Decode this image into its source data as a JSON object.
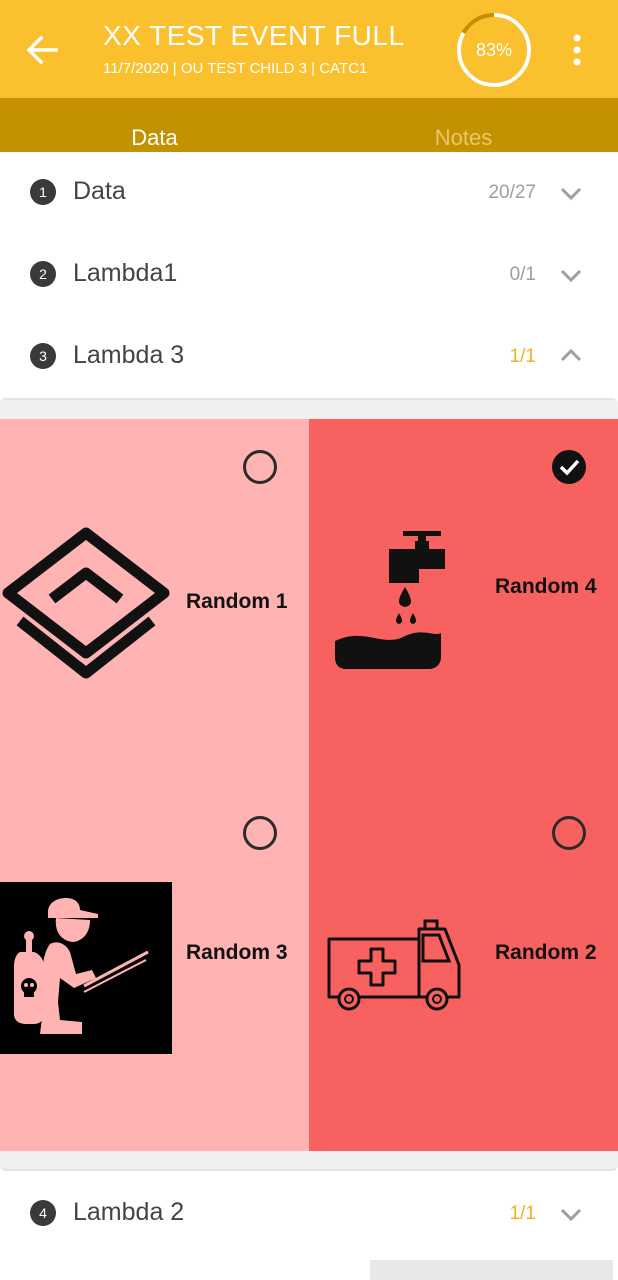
{
  "header": {
    "title": "XX TEST EVENT FULL",
    "subtitle": "11/7/2020 | OU TEST CHILD 3 | CATC1",
    "progress": "83%",
    "progress_fraction": 0.83,
    "back_icon": "arrow-left-icon",
    "more_icon": "more-vertical-icon"
  },
  "tabs": [
    {
      "label": "Data",
      "active": true
    },
    {
      "label": "Notes",
      "active": false
    }
  ],
  "sections": [
    {
      "number": "1",
      "label": "Data",
      "count": "20/27",
      "expanded": false,
      "complete": false
    },
    {
      "number": "2",
      "label": "Lambda1",
      "count": "0/1",
      "expanded": false,
      "complete": false
    },
    {
      "number": "3",
      "label": "Lambda 3",
      "count": "1/1",
      "expanded": true,
      "complete": true
    },
    {
      "number": "4",
      "label": "Lambda 2",
      "count": "1/1",
      "expanded": false,
      "complete": true
    }
  ],
  "options": [
    {
      "label": "Random 1",
      "icon": "layers-icon",
      "selected": false
    },
    {
      "label": "Random 4",
      "icon": "water-tap-icon",
      "selected": true
    },
    {
      "label": "Random 3",
      "icon": "pesticide-sprayer-icon",
      "selected": false
    },
    {
      "label": "Random 2",
      "icon": "ambulance-icon",
      "selected": false
    }
  ],
  "colors": {
    "header": "#fbc02d",
    "tabs": "#c49100",
    "option_light": "#ffb3b3",
    "option_dark": "#f76160",
    "count_complete": "#f0b020",
    "count_incomplete": "#9e9e9e"
  }
}
